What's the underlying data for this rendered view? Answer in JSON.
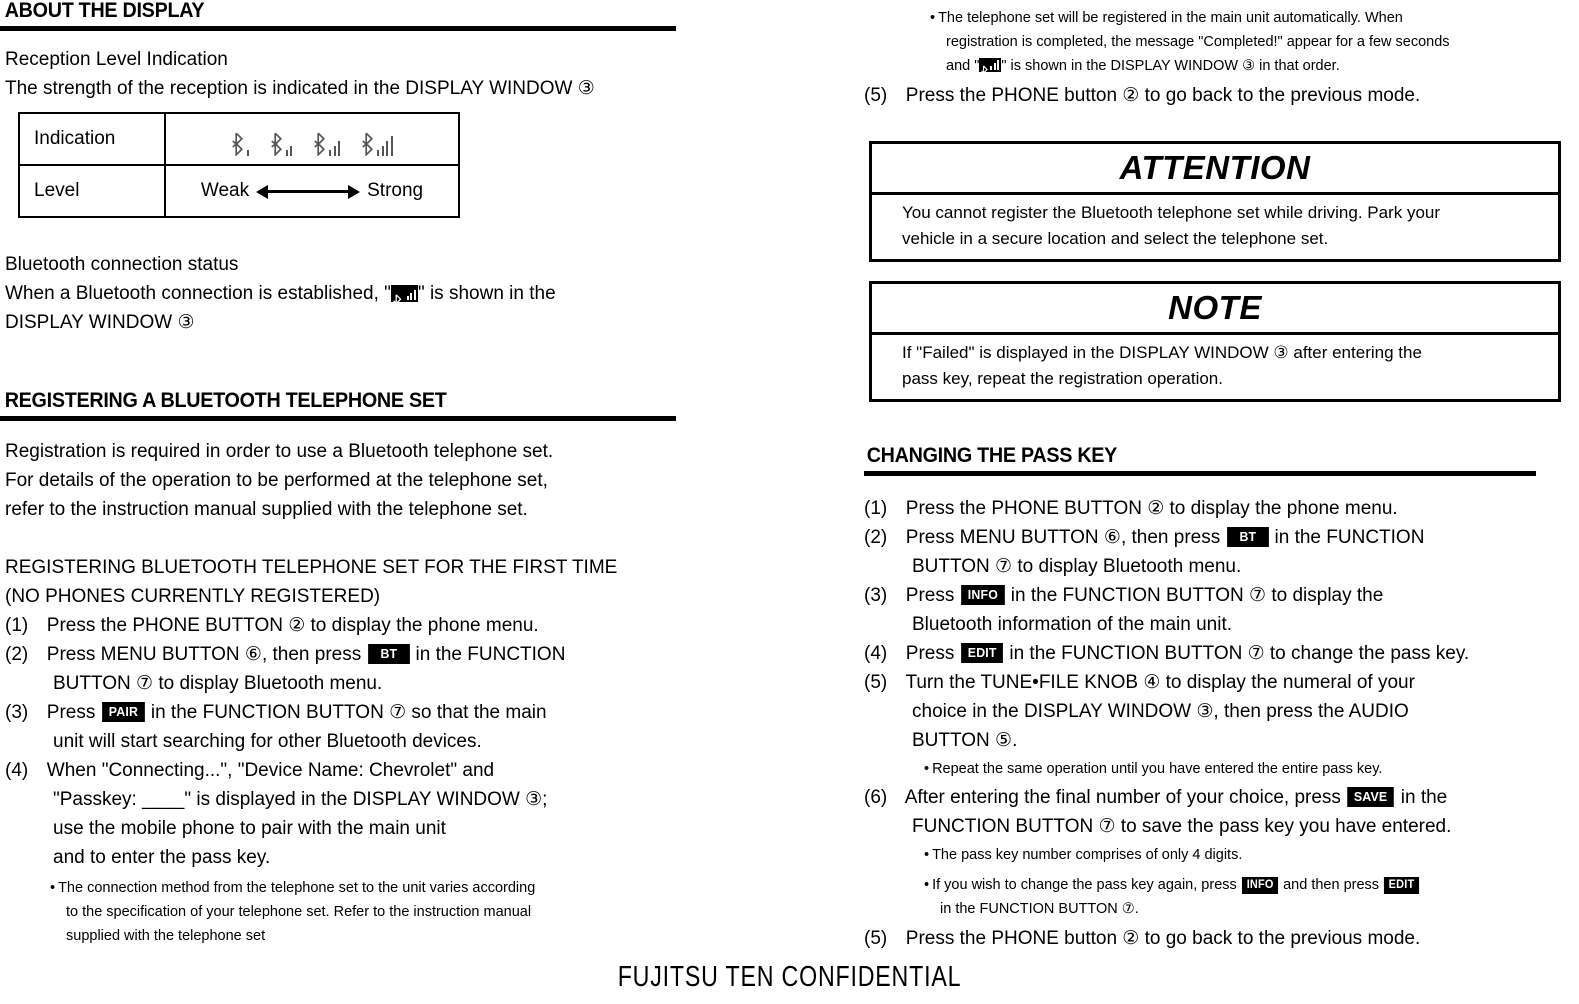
{
  "left_column": {
    "section1": {
      "heading": "ABOUT THE DISPLAY",
      "sub_heading": "Reception Level Indication",
      "intro_line": "The strength of the reception is indicated in the DISPLAY WINDOW",
      "intro_ref": "③",
      "table": {
        "row1_label": "Indication",
        "row2_label": "Level",
        "indications": [
          "bluetooth-1-bar",
          "bluetooth-2-bar",
          "bluetooth-3-bar",
          "bluetooth-4-bar"
        ],
        "level_weak": "Weak",
        "level_strong": "Strong"
      },
      "status_heading": "Bluetooth connection status",
      "status_line1_a": "When a Bluetooth connection is established, \"",
      "status_icon": "bluetooth-connected-inverted-icon",
      "status_line1_b": "\" is shown in the",
      "status_line2": "DISPLAY WINDOW",
      "status_line2_ref": "③"
    },
    "section2": {
      "heading": "REGISTERING A BLUETOOTH TELEPHONE SET",
      "intro": [
        "Registration is required in order to use a Bluetooth telephone set.",
        "For details of the operation to be performed at the telephone set,",
        "refer to the instruction manual supplied with the telephone set."
      ],
      "subtitle_line1": "REGISTERING BLUETOOTH TELEPHONE SET FOR THE FIRST TIME",
      "subtitle_line2": "(NO PHONES CURRENTLY REGISTERED)",
      "steps": {
        "s1_num": "(1)",
        "s1_text": "Press the PHONE BUTTON ② to display the phone menu.",
        "s2_num": "(2)",
        "s2_a": "Press MENU BUTTON ⑥, then press",
        "s2_key": "BT",
        "s2_b": "in the FUNCTION",
        "s2_cont": "BUTTON ⑦ to display Bluetooth menu.",
        "s3_num": "(3)",
        "s3_a": "Press",
        "s3_key": "PAIR",
        "s3_b": "in the FUNCTION BUTTON ⑦ so that the main",
        "s3_cont": "unit will start searching for other Bluetooth devices.",
        "s4_num": "(4)",
        "s4_l1": "When \"Connecting...\", \"Device Name: Chevrolet\" and",
        "s4_l2": "\"Passkey: ____\" is displayed in the DISPLAY WINDOW ③;",
        "s4_l3": "use the mobile phone to pair with the main unit",
        "s4_l4": "and to enter the pass key.",
        "s4_note1": "The connection method from the telephone set to the unit varies according",
        "s4_note2": "to the specification of your telephone set. Refer to the instruction manual",
        "s4_note3": "supplied with the telephone set"
      }
    }
  },
  "right_column": {
    "top_note": {
      "line1": "The telephone set will be registered in the main unit automatically. When",
      "line2": "registration is completed, the message \"Completed!\" appear for a few seconds",
      "line3_a": "and \"",
      "line3_icon": "bluetooth-connected-inverted-icon",
      "line3_b": "\" is shown in the DISPLAY WINDOW ③ in that order.",
      "step5_num": "(5)",
      "step5_text": "Press the PHONE button ② to go back to the previous mode."
    },
    "attention": {
      "title": "ATTENTION",
      "line1": "You cannot register the Bluetooth telephone set while driving. Park your",
      "line2": "vehicle  in a secure location and select the telephone set."
    },
    "note": {
      "title": "NOTE",
      "line1": "If \"Failed\" is displayed in the DISPLAY WINDOW  ③ after entering the",
      "line2": "pass key, repeat the registration operation."
    },
    "pass_key_section": {
      "heading": "CHANGING THE PASS KEY",
      "steps": {
        "s1_num": "(1)",
        "s1_text": "Press the PHONE BUTTON ② to display the phone menu.",
        "s2_num": "(2)",
        "s2_a": "Press MENU BUTTON ⑥, then press",
        "s2_key": "BT",
        "s2_b": "in the FUNCTION",
        "s2_cont": "BUTTON ⑦ to display Bluetooth menu.",
        "s3_num": "(3)",
        "s3_a": "Press",
        "s3_key": "INFO",
        "s3_b": "in the FUNCTION BUTTON ⑦ to display the",
        "s3_cont": "Bluetooth information of the main unit.",
        "s4_num": "(4)",
        "s4_a": "Press",
        "s4_key": "EDIT",
        "s4_b": "in the FUNCTION BUTTON ⑦ to change the pass key.",
        "s5_num": "(5)",
        "s5_l1": "Turn the TUNE•FILE KNOB ④ to display the numeral of your",
        "s5_l2": "choice in the DISPLAY WINDOW ③, then press the AUDIO",
        "s5_l3": "BUTTON ⑤.",
        "s5_note": "Repeat the same operation until you have entered the entire pass key.",
        "s6_num": "(6)",
        "s6_a": "After entering the final number of your choice, press",
        "s6_key": "SAVE",
        "s6_b": "in the",
        "s6_cont": "FUNCTION BUTTON ⑦ to save the pass key you have entered.",
        "s6_note1": "The pass key number comprises of only 4 digits.",
        "s6_note2_a": "If you wish to change the pass key again, press",
        "s6_note2_key1": "INFO",
        "s6_note2_b": "and then press",
        "s6_note2_key2": "EDIT",
        "s6_note2_cont": "in the FUNCTION BUTTON ⑦.",
        "s7_num": "(5)",
        "s7_text": "Press the PHONE button ② to go back to the previous mode."
      }
    }
  },
  "footer": {
    "text": "FUJITSU TEN CONFIDENTIAL"
  },
  "colors": {
    "ink": "#000000",
    "paper": "#ffffff",
    "icon_gray": "#555555"
  }
}
